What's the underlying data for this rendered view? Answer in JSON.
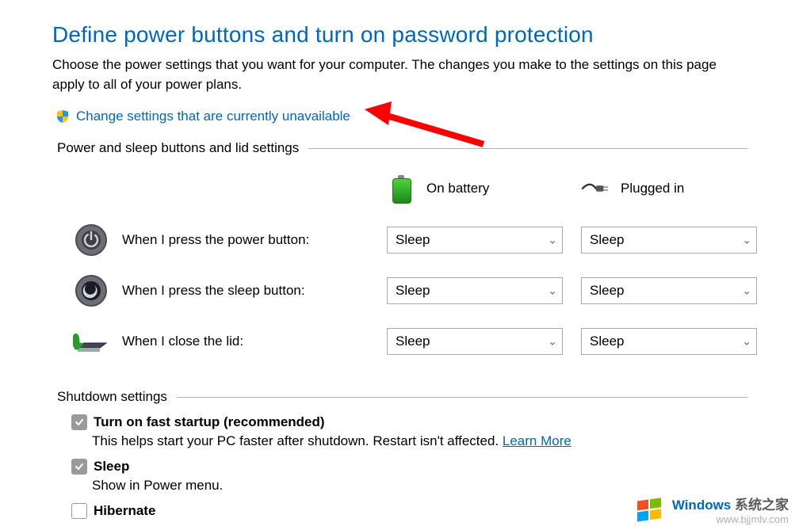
{
  "heading": "Define power buttons and turn on password protection",
  "subhead": "Choose the power settings that you want for your computer. The changes you make to the settings on this page apply to all of your power plans.",
  "admin_link": "Change settings that are currently unavailable",
  "section1_title": "Power and sleep buttons and lid settings",
  "columns": {
    "battery": "On battery",
    "plugged": "Plugged in"
  },
  "rows": {
    "power": {
      "label": "When I press the power button:",
      "battery": "Sleep",
      "plugged": "Sleep"
    },
    "sleep": {
      "label": "When I press the sleep button:",
      "battery": "Sleep",
      "plugged": "Sleep"
    },
    "lid": {
      "label": "When I close the lid:",
      "battery": "Sleep",
      "plugged": "Sleep"
    }
  },
  "section2_title": "Shutdown settings",
  "opts": {
    "fast": {
      "label": "Turn on fast startup (recommended)",
      "desc_a": "This helps start your PC faster after shutdown. Restart isn't affected. ",
      "learn_more": "Learn More"
    },
    "sleep": {
      "label": "Sleep",
      "desc": "Show in Power menu."
    },
    "hiber": {
      "label": "Hibernate"
    }
  },
  "watermark": {
    "brand_blue": "Windows",
    "brand_gray": " 系统之家",
    "url": "www.bjjmlv.com"
  }
}
